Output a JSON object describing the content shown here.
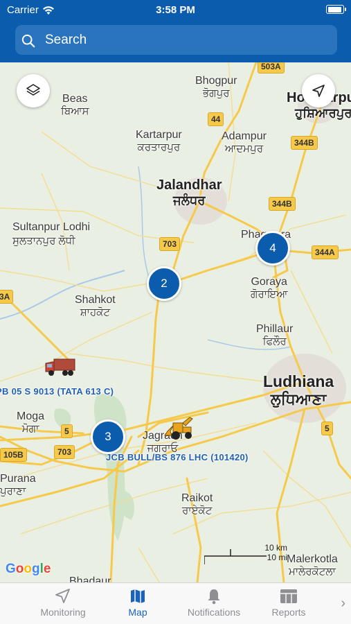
{
  "status_bar": {
    "carrier": "Carrier",
    "time": "3:58 PM"
  },
  "search": {
    "placeholder": "Search"
  },
  "map": {
    "places": [
      {
        "name": "Beas",
        "local": "ਬਿਆਸ"
      },
      {
        "name": "Bhogpur",
        "local": "ਭੋਗਪੁਰ"
      },
      {
        "name": "Hoshiarpur",
        "local": "ਹੁਸ਼ਿਆਰਪੁਰ"
      },
      {
        "name": "Kartarpur",
        "local": "ਕਰਤਾਰਪੁਰ"
      },
      {
        "name": "Adampur",
        "local": "ਆਦਮਪੁਰ"
      },
      {
        "name": "Jalandhar",
        "local": "ਜਲੰਧਰ"
      },
      {
        "name": "Sultanpur Lodhi",
        "local": "ਸੁਲਤਾਨਪੁਰ ਲੋਧੀ"
      },
      {
        "name": "Phagwara",
        "local": ""
      },
      {
        "name": "Goraya",
        "local": "ਗੋਰਾਇਆ"
      },
      {
        "name": "Shahkot",
        "local": "ਸ਼ਾਹਕੋਟ"
      },
      {
        "name": "Phillaur",
        "local": "ਫਿਲੌਰ"
      },
      {
        "name": "Ludhiana",
        "local": "ਲੁਧਿਆਣਾ"
      },
      {
        "name": "Moga",
        "local": "ਮੋਗਾ"
      },
      {
        "name": "Jagraon",
        "local": "ਜਗਰਾਓ"
      },
      {
        "name": "Purana",
        "local": "ਪੁਰਾਣਾ"
      },
      {
        "name": "Raikot",
        "local": "ਰਾਏਕੋਟ"
      },
      {
        "name": "Malerkotla",
        "local": "ਮਾਲੇਰਕੋਟਲਾ"
      },
      {
        "name": "Bhadaur",
        "local": ""
      }
    ],
    "highway_shields": [
      "503A",
      "44",
      "344B",
      "344B",
      "703",
      "344A",
      "3A",
      "5",
      "5",
      "105B",
      "703"
    ],
    "clusters": [
      {
        "count": "2"
      },
      {
        "count": "4"
      },
      {
        "count": "3"
      }
    ],
    "vehicles": [
      {
        "label": "PB 05 S 9013 (TATA 613 C)",
        "type": "truck"
      },
      {
        "label": "JCB BULL/BS 876 LHC (101420)",
        "type": "loader"
      }
    ],
    "scale": {
      "km": "10 km",
      "mi": "10 mi"
    },
    "attribution": "Google"
  },
  "tabs": [
    {
      "label": "Monitoring",
      "icon": "navigation-arrow-icon"
    },
    {
      "label": "Map",
      "icon": "map-icon",
      "active": true
    },
    {
      "label": "Notifications",
      "icon": "bell-icon"
    },
    {
      "label": "Reports",
      "icon": "reports-icon"
    }
  ],
  "colors": {
    "primary": "#0b5cad",
    "search_bg": "#2a74bd",
    "cluster": "#0b5cad",
    "tab_active": "#1a63b8",
    "road": "#f6c94a"
  }
}
